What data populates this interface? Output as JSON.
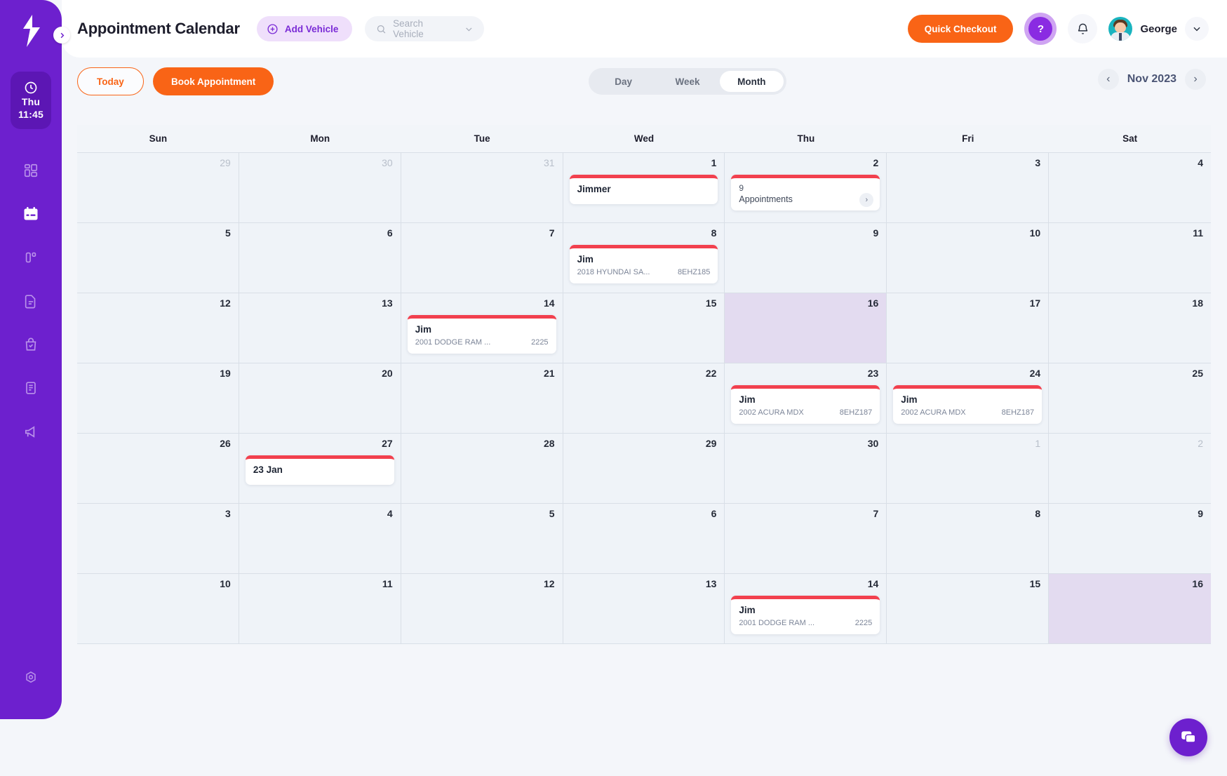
{
  "app": {
    "page_title": "Appointment Calendar",
    "add_vehicle_label": "Add Vehicle",
    "search_placeholder": "Search Vehicle",
    "quick_checkout_label": "Quick Checkout",
    "user_name": "George",
    "help_glyph": "?",
    "accent_orange": "#f96416",
    "brand_purple": "#6d20ce",
    "event_red": "#f2404e"
  },
  "sidebar": {
    "clock": {
      "day": "Thu",
      "time": "11:45"
    },
    "items": [
      {
        "name": "dashboard",
        "icon": "dashboard-icon"
      },
      {
        "name": "calendar",
        "icon": "calendar-icon",
        "active": true
      },
      {
        "name": "board",
        "icon": "board-icon"
      },
      {
        "name": "documents",
        "icon": "document-icon"
      },
      {
        "name": "orders",
        "icon": "shopping-bag-icon"
      },
      {
        "name": "reports",
        "icon": "report-icon"
      },
      {
        "name": "announcements",
        "icon": "megaphone-icon"
      }
    ],
    "settings_icon": "gear-icon"
  },
  "toolbar": {
    "today_label": "Today",
    "book_label": "Book Appointment",
    "views": [
      {
        "label": "Day",
        "active": false
      },
      {
        "label": "Week",
        "active": false
      },
      {
        "label": "Month",
        "active": true
      }
    ],
    "month_label": "Nov 2023",
    "prev_glyph": "‹",
    "next_glyph": "›"
  },
  "calendar": {
    "weekdays": [
      "Sun",
      "Mon",
      "Tue",
      "Wed",
      "Thu",
      "Fri",
      "Sat"
    ],
    "weeks": [
      [
        {
          "day": "29",
          "muted": true
        },
        {
          "day": "30",
          "muted": true
        },
        {
          "day": "31",
          "muted": true
        },
        {
          "day": "1",
          "appt": {
            "kind": "event",
            "title": "Jimmer"
          }
        },
        {
          "day": "2",
          "appt": {
            "kind": "count",
            "count": "9",
            "label": "Appointments",
            "arrow": "›"
          }
        },
        {
          "day": "3"
        },
        {
          "day": "4"
        }
      ],
      [
        {
          "day": "5"
        },
        {
          "day": "6"
        },
        {
          "day": "7"
        },
        {
          "day": "8",
          "appt": {
            "kind": "event",
            "title": "Jim",
            "vehicle": "2018 HYUNDAI SA...",
            "plate": "8EHZ185"
          }
        },
        {
          "day": "9"
        },
        {
          "day": "10"
        },
        {
          "day": "11"
        }
      ],
      [
        {
          "day": "12"
        },
        {
          "day": "13"
        },
        {
          "day": "14",
          "appt": {
            "kind": "event",
            "title": "Jim",
            "vehicle": "2001 DODGE RAM ...",
            "plate": "2225"
          }
        },
        {
          "day": "15"
        },
        {
          "day": "16",
          "today": true
        },
        {
          "day": "17"
        },
        {
          "day": "18"
        }
      ],
      [
        {
          "day": "19"
        },
        {
          "day": "20"
        },
        {
          "day": "21"
        },
        {
          "day": "22"
        },
        {
          "day": "23",
          "appt": {
            "kind": "event",
            "title": "Jim",
            "vehicle": "2002 ACURA MDX",
            "plate": "8EHZ187"
          }
        },
        {
          "day": "24",
          "appt": {
            "kind": "event",
            "title": "Jim",
            "vehicle": "2002 ACURA MDX",
            "plate": "8EHZ187"
          }
        },
        {
          "day": "25"
        }
      ],
      [
        {
          "day": "26"
        },
        {
          "day": "27",
          "appt": {
            "kind": "event",
            "title": "23 Jan"
          }
        },
        {
          "day": "28"
        },
        {
          "day": "29"
        },
        {
          "day": "30"
        },
        {
          "day": "1",
          "muted": true
        },
        {
          "day": "2",
          "muted": true
        }
      ],
      [
        {
          "day": "3"
        },
        {
          "day": "4"
        },
        {
          "day": "5"
        },
        {
          "day": "6"
        },
        {
          "day": "7"
        },
        {
          "day": "8"
        },
        {
          "day": "9"
        }
      ],
      [
        {
          "day": "10"
        },
        {
          "day": "11"
        },
        {
          "day": "12"
        },
        {
          "day": "13"
        },
        {
          "day": "14",
          "appt": {
            "kind": "event",
            "title": "Jim",
            "vehicle": "2001 DODGE RAM ...",
            "plate": "2225"
          }
        },
        {
          "day": "15"
        },
        {
          "day": "16",
          "today": true
        }
      ]
    ]
  },
  "chat": {
    "icon": "chat-bubble-icon"
  }
}
